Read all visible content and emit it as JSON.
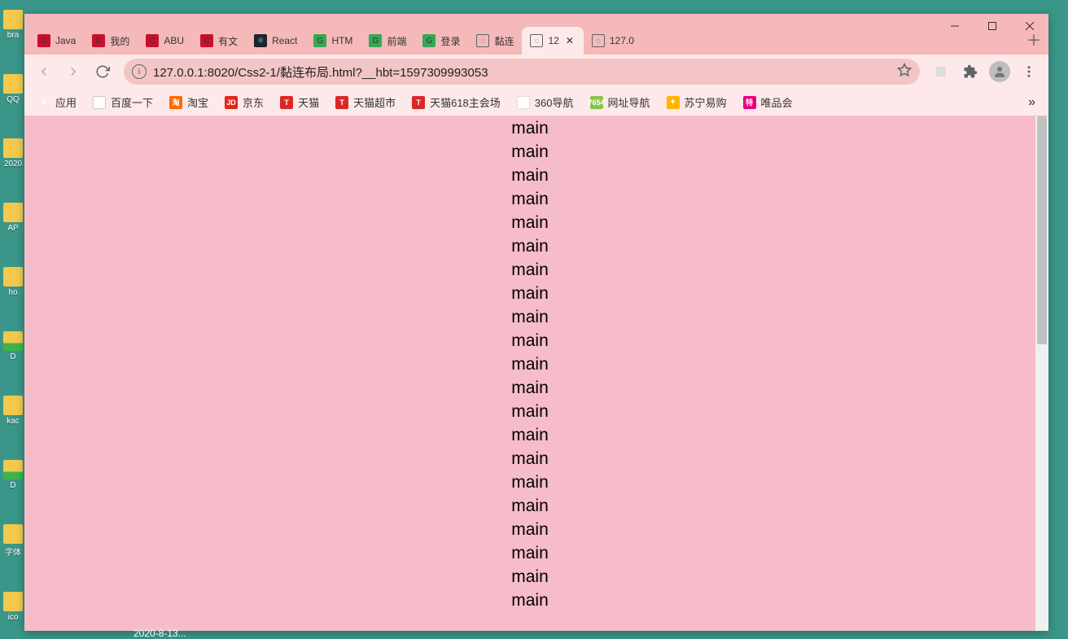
{
  "desktop_icons": [
    {
      "label": "bra",
      "kind": "app"
    },
    {
      "label": "QQ",
      "kind": "folder"
    },
    {
      "label": "2020",
      "kind": "folder"
    },
    {
      "label": "AP",
      "kind": "folder"
    },
    {
      "label": "ho",
      "kind": "folder"
    },
    {
      "label": "D",
      "kind": "zip"
    },
    {
      "label": "kac",
      "kind": "folder"
    },
    {
      "label": "D",
      "kind": "zip"
    },
    {
      "label": "字体",
      "kind": "folder"
    },
    {
      "label": "ico",
      "kind": "folder"
    }
  ],
  "tabs": [
    {
      "favicon": "C",
      "fc": "fc-red",
      "label": "Java"
    },
    {
      "favicon": "C",
      "fc": "fc-red",
      "label": "我的"
    },
    {
      "favicon": "C",
      "fc": "fc-red",
      "label": "ABU"
    },
    {
      "favicon": "C",
      "fc": "fc-red",
      "label": "有文"
    },
    {
      "favicon": "⚛",
      "fc": "fc-react",
      "label": "React"
    },
    {
      "favicon": "G",
      "fc": "fc-green",
      "label": "HTM"
    },
    {
      "favicon": "G",
      "fc": "fc-green",
      "label": "前端"
    },
    {
      "favicon": "G",
      "fc": "fc-green",
      "label": "登录"
    },
    {
      "favicon": "◌",
      "fc": "fc-globe",
      "label": "黏连"
    },
    {
      "favicon": "◌",
      "fc": "fc-globe",
      "label": "12",
      "active": true,
      "closable": true
    },
    {
      "favicon": "◌",
      "fc": "fc-globe",
      "label": "127.0"
    }
  ],
  "newtab_glyph": "＋",
  "url": "127.0.0.1:8020/Css2-1/黏连布局.html?__hbt=1597309993053",
  "bookmarks": [
    {
      "favicon": "⠿",
      "fc": "fc-apps",
      "label": "应用"
    },
    {
      "favicon": "✦",
      "fc": "fc-baidu",
      "label": "百度一下"
    },
    {
      "favicon": "淘",
      "fc": "fc-tao",
      "label": "淘宝"
    },
    {
      "favicon": "JD",
      "fc": "fc-jd",
      "label": "京东"
    },
    {
      "favicon": "T",
      "fc": "fc-tmall",
      "label": "天猫"
    },
    {
      "favicon": "T",
      "fc": "fc-tmall",
      "label": "天猫超市"
    },
    {
      "favicon": "T",
      "fc": "fc-tmall",
      "label": "天猫618主会场"
    },
    {
      "favicon": " ",
      "fc": "fc-360",
      "label": "360导航"
    },
    {
      "favicon": "7654",
      "fc": "fc-7654",
      "label": "网址导航"
    },
    {
      "favicon": "✦",
      "fc": "fc-su",
      "label": "苏宁易购"
    },
    {
      "favicon": "特",
      "fc": "fc-vip",
      "label": "唯品会"
    }
  ],
  "bookmarks_overflow": "»",
  "page_lines": [
    "main",
    "main",
    "main",
    "main",
    "main",
    "main",
    "main",
    "main",
    "main",
    "main",
    "main",
    "main",
    "main",
    "main",
    "main",
    "main",
    "main",
    "main",
    "main",
    "main",
    "main"
  ],
  "taskbar_fragment": "2020-8-13..."
}
